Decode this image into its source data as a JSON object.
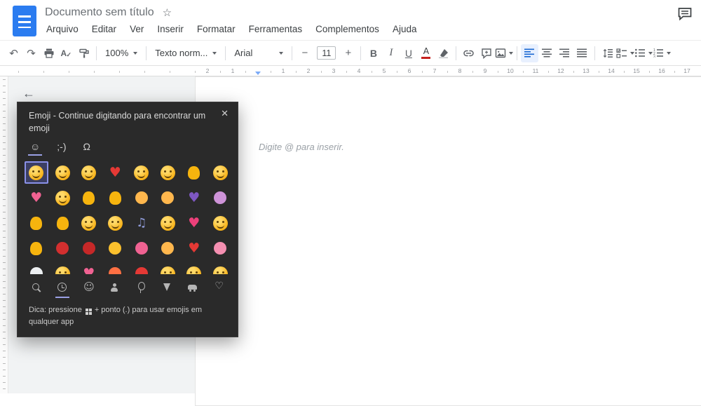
{
  "header": {
    "title": "Documento sem título",
    "star": "☆",
    "menus": [
      "Arquivo",
      "Editar",
      "Ver",
      "Inserir",
      "Formatar",
      "Ferramentas",
      "Complementos",
      "Ajuda"
    ]
  },
  "toolbar": {
    "undo": "↶",
    "redo": "↷",
    "spellcheck": "A",
    "zoom": "100%",
    "styles": "Texto norm...",
    "font": "Arial",
    "minus": "−",
    "font_size": "11",
    "plus": "+",
    "bold": "B",
    "italic": "I",
    "underline": "U",
    "text_color": "A"
  },
  "ruler": {
    "marks": [
      {
        "pos": -2,
        "label": "2"
      },
      {
        "pos": -1,
        "label": "1"
      },
      {
        "pos": 1,
        "label": "1"
      },
      {
        "pos": 2,
        "label": "2"
      },
      {
        "pos": 3,
        "label": "3"
      },
      {
        "pos": 4,
        "label": "4"
      },
      {
        "pos": 5,
        "label": "5"
      },
      {
        "pos": 6,
        "label": "6"
      },
      {
        "pos": 7,
        "label": "7"
      },
      {
        "pos": 8,
        "label": "8"
      },
      {
        "pos": 9,
        "label": "9"
      },
      {
        "pos": 10,
        "label": "10"
      },
      {
        "pos": 11,
        "label": "11"
      },
      {
        "pos": 12,
        "label": "12"
      },
      {
        "pos": 13,
        "label": "13"
      },
      {
        "pos": 14,
        "label": "14"
      },
      {
        "pos": 15,
        "label": "15"
      },
      {
        "pos": 16,
        "label": "16"
      },
      {
        "pos": 17,
        "label": "17"
      }
    ]
  },
  "document": {
    "placeholder": "Digite @ para inserir."
  },
  "back_arrow": "←",
  "emoji": {
    "title": "Emoji - Continue digitando para encontrar um emoji",
    "close": "✕",
    "tabs": [
      {
        "name": "tab-emoji",
        "label": "☺",
        "selected": true
      },
      {
        "name": "tab-kaomoji",
        "label": ";-)"
      },
      {
        "name": "tab-symbols",
        "label": "Ω"
      }
    ],
    "selected_index": 0,
    "grid": [
      {
        "n": "smiling-face-smiling-eyes",
        "char": "😊",
        "k": "face"
      },
      {
        "n": "face-tears-of-joy",
        "char": "😂",
        "k": "face"
      },
      {
        "n": "rolling-on-floor-laughing",
        "char": "🤣",
        "k": "face"
      },
      {
        "n": "red-heart",
        "char": "❤️",
        "k": "heart",
        "c": "#e53935"
      },
      {
        "n": "heart-eyes",
        "char": "😍",
        "k": "face"
      },
      {
        "n": "unamused-face",
        "char": "😒",
        "k": "face"
      },
      {
        "n": "ok-hand",
        "char": "👌",
        "k": "hand"
      },
      {
        "n": "face-blowing-kiss",
        "char": "😘",
        "k": "face"
      },
      {
        "n": "two-hearts",
        "char": "💕",
        "k": "heart",
        "c": "#f06292"
      },
      {
        "n": "beaming-face",
        "char": "😁",
        "k": "face"
      },
      {
        "n": "thumbs-up",
        "char": "👍",
        "k": "hand"
      },
      {
        "n": "raising-hands",
        "char": "🙌",
        "k": "hand"
      },
      {
        "n": "person-facepalming",
        "char": "🤦",
        "k": "blob",
        "c": "#ffb74d"
      },
      {
        "n": "person-shrugging",
        "char": "🤷",
        "k": "blob",
        "c": "#ffb74d"
      },
      {
        "n": "purple-heart",
        "char": "💜",
        "k": "heart",
        "c": "#7e57c2"
      },
      {
        "n": "fairy",
        "char": "🧚",
        "k": "blob",
        "c": "#ce93d8"
      },
      {
        "n": "victory-hand",
        "char": "✌️",
        "k": "hand"
      },
      {
        "n": "crossed-fingers",
        "char": "🤞",
        "k": "hand"
      },
      {
        "n": "winking-face",
        "char": "😉",
        "k": "face"
      },
      {
        "n": "smiling-face-sunglasses",
        "char": "😎",
        "k": "face"
      },
      {
        "n": "musical-notes",
        "char": "🎶",
        "k": "glyph",
        "g": "♫",
        "c": "#8f9bd8"
      },
      {
        "n": "loudly-crying-face",
        "char": "😭",
        "k": "face"
      },
      {
        "n": "heart-with-arrow",
        "char": "💘",
        "k": "heart",
        "c": "#ec407a"
      },
      {
        "n": "hugging-face",
        "char": "🤗",
        "k": "face"
      },
      {
        "n": "clapping-hands",
        "char": "👏",
        "k": "hand"
      },
      {
        "n": "kiss-mark",
        "char": "💋",
        "k": "blob",
        "c": "#d32f2f"
      },
      {
        "n": "rose",
        "char": "🌹",
        "k": "blob",
        "c": "#c62828"
      },
      {
        "n": "party-popper",
        "char": "🎉",
        "k": "blob",
        "c": "#fbc02d"
      },
      {
        "n": "birthday-cake",
        "char": "🎂",
        "k": "blob",
        "c": "#f06292"
      },
      {
        "n": "selfie",
        "char": "🤳",
        "k": "blob",
        "c": "#ffb74d"
      },
      {
        "n": "broken-heart",
        "char": "💔",
        "k": "heart",
        "c": "#e53935"
      },
      {
        "n": "unicorn",
        "char": "🦄",
        "k": "blob",
        "c": "#f48fb1"
      },
      {
        "n": "eyes",
        "char": "👀",
        "k": "blob",
        "c": "#eceff1"
      },
      {
        "n": "smirking-face",
        "char": "😏",
        "k": "face"
      },
      {
        "n": "sparkling-heart",
        "char": "💖",
        "k": "heart",
        "c": "#f06292"
      },
      {
        "n": "fire",
        "char": "🔥",
        "k": "blob",
        "c": "#ff7043"
      },
      {
        "n": "hundred-points",
        "char": "💯",
        "k": "blob",
        "c": "#e53935"
      },
      {
        "n": "thinking-face",
        "char": "🤔",
        "k": "face"
      },
      {
        "n": "star-struck",
        "char": "🤩",
        "k": "face"
      },
      {
        "n": "sleeping-face",
        "char": "😴",
        "k": "face"
      }
    ],
    "categories": [
      {
        "n": "search"
      },
      {
        "n": "recent",
        "selected": true
      },
      {
        "n": "smileys"
      },
      {
        "n": "people"
      },
      {
        "n": "celebrations"
      },
      {
        "n": "food"
      },
      {
        "n": "transport"
      },
      {
        "n": "symbols"
      }
    ],
    "tip_before": "Dica: pressione",
    "tip_after": "+ ponto (.) para usar emojis em qualquer app"
  },
  "colors": {
    "accent": "#9aa0e5",
    "docs_blue": "#2b7cf0",
    "selection_border": "#8a91e8",
    "panel_bg": "#2a2a2a"
  }
}
